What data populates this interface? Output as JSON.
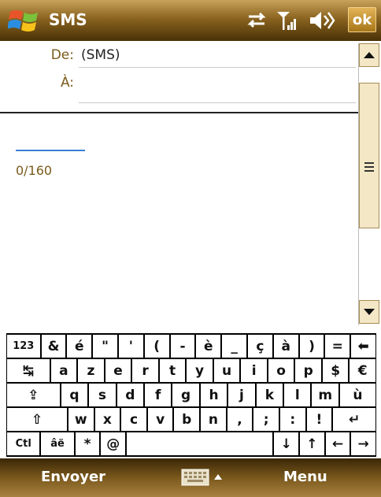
{
  "titlebar": {
    "title": "SMS",
    "ok_label": "ok",
    "icons": [
      "windows-start-icon",
      "sync-arrows-icon",
      "signal-strength-icon",
      "volume-icon"
    ]
  },
  "header": {
    "from_label": "De:",
    "from_value": "(SMS)",
    "to_label": "À:",
    "to_value": ""
  },
  "message": {
    "body": "",
    "counter": "0/160"
  },
  "keyboard": {
    "rows": [
      [
        "123",
        "&",
        "é",
        "\"",
        "'",
        "(",
        "-",
        "è",
        "_",
        "ç",
        "à",
        ")",
        "=",
        "⬅"
      ],
      [
        "↹",
        "a",
        "z",
        "e",
        "r",
        "t",
        "y",
        "u",
        "i",
        "o",
        "p",
        "$",
        "€"
      ],
      [
        "⇪",
        "q",
        "s",
        "d",
        "f",
        "g",
        "h",
        "j",
        "k",
        "l",
        "m",
        "ù"
      ],
      [
        "⇧",
        "w",
        "x",
        "c",
        "v",
        "b",
        "n",
        ",",
        ";",
        ":",
        "!",
        "↵"
      ],
      [
        "Ctl",
        "âë",
        "*",
        "@",
        "",
        "↓",
        "↑",
        "←",
        "→"
      ]
    ]
  },
  "softkeys": {
    "left": "Envoyer",
    "right": "Menu"
  }
}
